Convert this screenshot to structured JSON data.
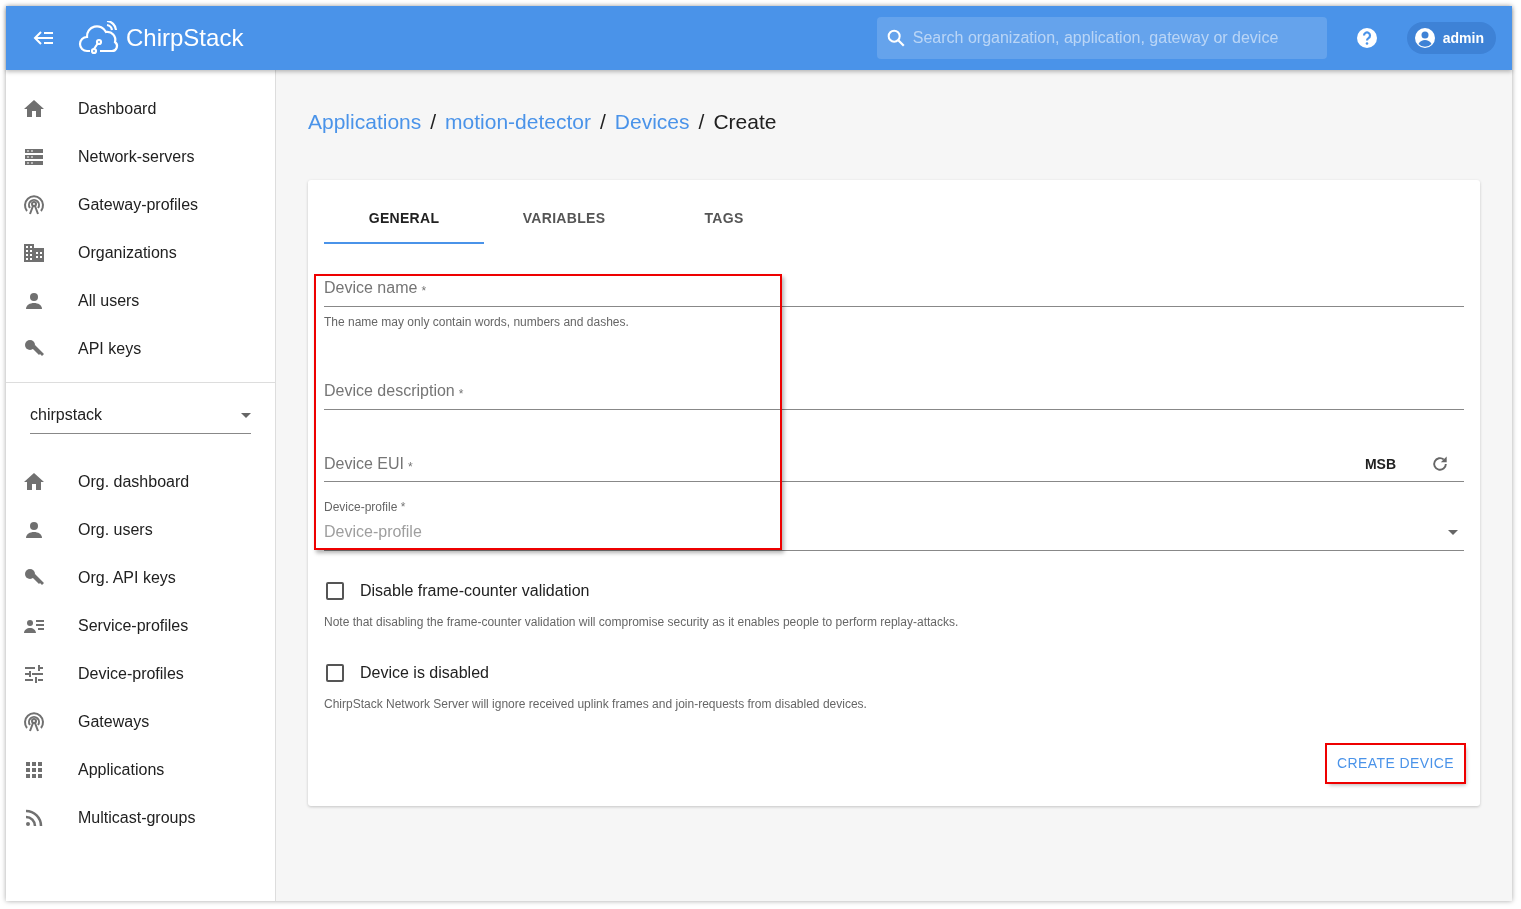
{
  "header": {
    "logo_text": "ChirpStack",
    "search": {
      "placeholder": "Search organization, application, gateway or device"
    },
    "user": "admin"
  },
  "sidebar": {
    "items": [
      {
        "label": "Dashboard"
      },
      {
        "label": "Network-servers"
      },
      {
        "label": "Gateway-profiles"
      },
      {
        "label": "Organizations"
      },
      {
        "label": "All users"
      },
      {
        "label": "API keys"
      }
    ],
    "organization_select": {
      "value": "chirpstack"
    },
    "org_items": [
      {
        "label": "Org. dashboard"
      },
      {
        "label": "Org. users"
      },
      {
        "label": "Org. API keys"
      },
      {
        "label": "Service-profiles"
      },
      {
        "label": "Device-profiles"
      },
      {
        "label": "Gateways"
      },
      {
        "label": "Applications"
      },
      {
        "label": "Multicast-groups"
      }
    ]
  },
  "breadcrumb": [
    {
      "label": "Applications",
      "link": true
    },
    {
      "separator": "/",
      "label": "motion-detector",
      "link": true
    },
    {
      "separator": "/",
      "label": "Devices",
      "link": true
    },
    {
      "separator": "/",
      "label": "Create",
      "link": false
    }
  ],
  "tabs": [
    {
      "label": "GENERAL",
      "selected": true
    },
    {
      "label": "VARIABLES",
      "selected": false
    },
    {
      "label": "TAGS",
      "selected": false
    }
  ],
  "form": {
    "highlighted": true,
    "fields": [
      {
        "kind": "text",
        "label": "Device name",
        "required_mark": "*",
        "helper": "The name may only contain words, numbers and dashes."
      },
      {
        "kind": "text",
        "label": "Device description",
        "required_mark": "*"
      },
      {
        "kind": "eui",
        "label": "Device EUI",
        "required_mark": "*",
        "byte_order": "MSB"
      },
      {
        "kind": "select",
        "label": "Device-profile",
        "required_mark": "*",
        "placeholder": "Device-profile"
      }
    ],
    "checkboxes": [
      {
        "label": "Disable frame-counter validation",
        "checked": false,
        "note": "Note that disabling the frame-counter validation will compromise security as it enables people to perform replay-attacks."
      },
      {
        "label": "Device is disabled",
        "checked": false,
        "note": "ChirpStack Network Server will ignore received uplink frames and join-requests from disabled devices."
      }
    ],
    "submit": {
      "label": "CREATE DEVICE",
      "highlighted": true
    }
  }
}
